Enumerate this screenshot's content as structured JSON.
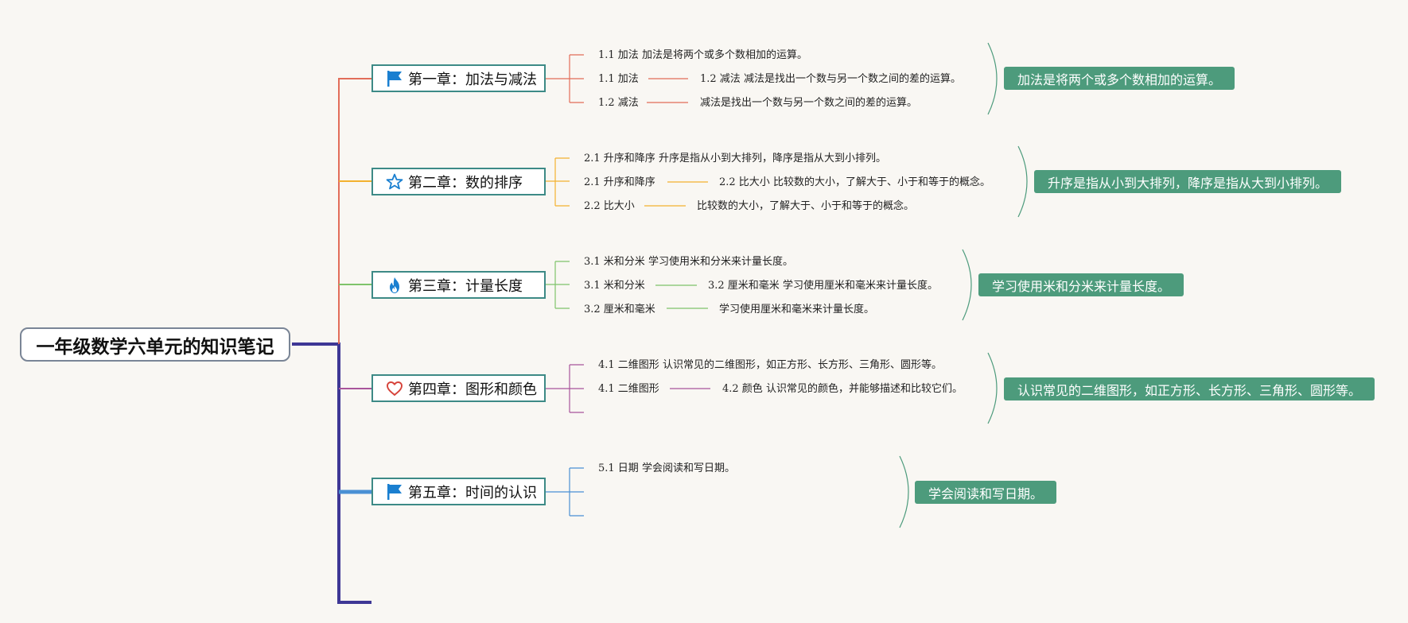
{
  "title": "一年级数学六单元的知识笔记",
  "colors": {
    "trunk": "#3e3795",
    "chapter_border": "#3d8a86",
    "summary_bg": "#4d9b7c",
    "branch_1": "#e26d59",
    "branch_2": "#f3b12e",
    "branch_3": "#7fc36a",
    "branch_4": "#a9549b",
    "branch_5": "#4a90d4"
  },
  "chapters": [
    {
      "label": "第一章：加法与减法",
      "icon": "flag-icon",
      "notes": {
        "line1": "1.1 加法 加法是将两个或多个数相加的运算。",
        "line2a": "1.1 加法",
        "line2b": "1.2 减法 减法是找出一个数与另一个数之间的差的运算。",
        "line3a": "1.2 减法",
        "line3b": "减法是找出一个数与另一个数之间的差的运算。"
      },
      "summary": "加法是将两个或多个数相加的运算。"
    },
    {
      "label": "第二章：数的排序",
      "icon": "star-icon",
      "notes": {
        "line1": "2.1 升序和降序 升序是指从小到大排列，降序是指从大到小排列。",
        "line2a": "2.1 升序和降序",
        "line2b": "2.2 比大小 比较数的大小，了解大于、小于和等于的概念。",
        "line3a": "2.2 比大小",
        "line3b": "比较数的大小，了解大于、小于和等于的概念。"
      },
      "summary": "升序是指从小到大排列，降序是指从大到小排列。"
    },
    {
      "label": "第三章：计量长度",
      "icon": "flame-icon",
      "notes": {
        "line1": "3.1 米和分米 学习使用米和分米来计量长度。",
        "line2a": "3.1 米和分米",
        "line2b": "3.2 厘米和毫米 学习使用厘米和毫米来计量长度。",
        "line3a": "3.2 厘米和毫米",
        "line3b": "学习使用厘米和毫米来计量长度。"
      },
      "summary": "学习使用米和分米来计量长度。"
    },
    {
      "label": "第四章：图形和颜色",
      "icon": "heart-icon",
      "notes": {
        "line1": "4.1 二维图形 认识常见的二维图形，如正方形、长方形、三角形、圆形等。",
        "line2a": "4.1 二维图形",
        "line2b": "4.2 颜色 认识常见的颜色，并能够描述和比较它们。",
        "line3a": "",
        "line3b": ""
      },
      "summary": "认识常见的二维图形，如正方形、长方形、三角形、圆形等。"
    },
    {
      "label": "第五章：时间的认识",
      "icon": "flag-icon",
      "notes": {
        "line1": "5.1 日期 学会阅读和写日期。",
        "line2a": "",
        "line2b": "",
        "line3a": "",
        "line3b": ""
      },
      "summary": "学会阅读和写日期。"
    }
  ]
}
